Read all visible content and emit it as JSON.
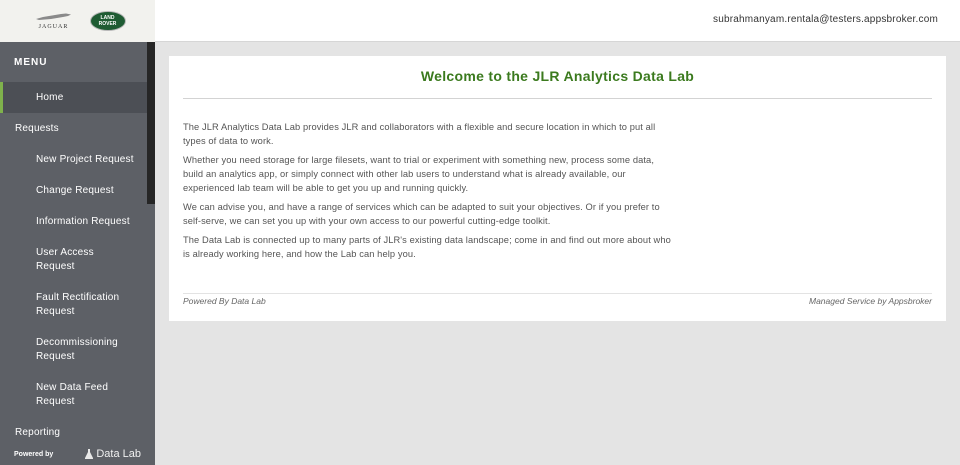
{
  "header": {
    "jaguar_text": "JAGUAR",
    "landrover_text_1": "LAND",
    "landrover_text_2": "ROVER",
    "user_email": "subrahmanyam.rentala@testers.appsbroker.com"
  },
  "sidebar": {
    "menu_label": "MENU",
    "items": [
      {
        "label": "Home"
      },
      {
        "label": "Requests"
      },
      {
        "label": "New Project Request"
      },
      {
        "label": "Change Request"
      },
      {
        "label": "Information Request"
      },
      {
        "label": "User Access",
        "label2": "Request"
      },
      {
        "label": "Fault Rectification",
        "label2": "Request"
      },
      {
        "label": "Decommissioning",
        "label2": "Request"
      },
      {
        "label": "New Data Feed",
        "label2": "Request"
      },
      {
        "label": "Reporting"
      }
    ],
    "powered_by": "Powered by",
    "powered_logo": "Data Lab"
  },
  "main": {
    "title": "Welcome to the JLR Analytics Data Lab",
    "paragraphs": [
      "The JLR Analytics Data Lab provides JLR and collaborators with a flexible and secure location in which to put all types of data to work.",
      "Whether you need storage for large filesets, want to trial or experiment with something new, process some data, build an analytics app, or simply connect with other lab users to understand what is already available, our experienced lab team will be able to get you up and running quickly.",
      "We can advise you, and have a range of services which can be adapted to suit your objectives. Or if you prefer to self-serve, we can set you up with your own access to our powerful cutting-edge toolkit.",
      "The Data Lab is connected up to many parts of JLR's existing data landscape; come in and find out more about who is already working here, and how the Lab can help you."
    ],
    "footer_left": "Powered By Data Lab",
    "footer_right": "Managed Service by Appsbroker"
  },
  "colors": {
    "accent_green": "#3b7a1e",
    "sidebar_bg": "#5d6066",
    "active_indicator": "#7fb24c"
  }
}
